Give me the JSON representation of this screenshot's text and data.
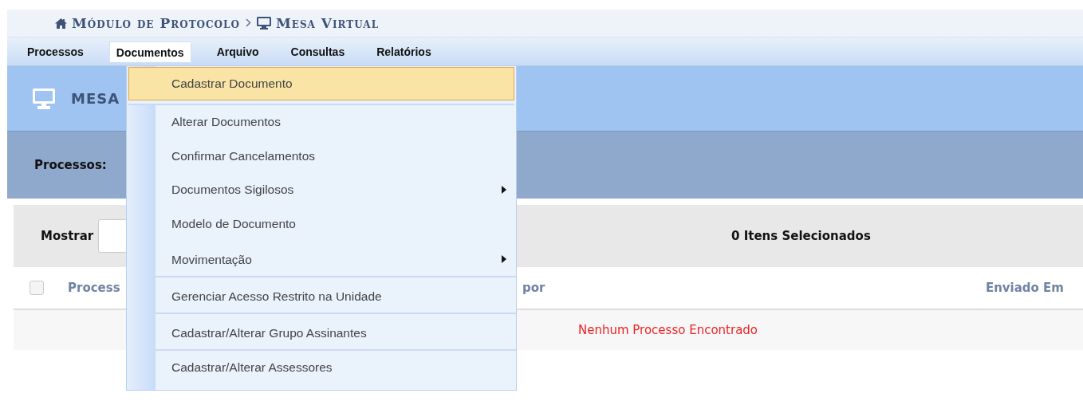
{
  "breadcrumb": [
    {
      "kind": "home",
      "text": "Módulo de Protocolo"
    },
    {
      "kind": "desk",
      "text": "Mesa Virtual"
    }
  ],
  "menu": [
    {
      "label": "Processos",
      "selected": false
    },
    {
      "label": "Documentos",
      "selected": true
    },
    {
      "label": "Arquivo",
      "selected": false
    },
    {
      "label": "Consultas",
      "selected": false
    },
    {
      "label": "Relatórios",
      "selected": false
    }
  ],
  "dropdown": [
    {
      "label": "Cadastrar Documento",
      "selected": true,
      "submenu": false,
      "separator_after": true
    },
    {
      "label": "Alterar Documentos",
      "selected": false,
      "submenu": false,
      "separator_after": false
    },
    {
      "label": "Confirmar Cancelamentos",
      "selected": false,
      "submenu": false,
      "separator_after": false
    },
    {
      "label": "Documentos Sigilosos",
      "selected": false,
      "submenu": true,
      "separator_after": false
    },
    {
      "label": "Modelo de Documento",
      "selected": false,
      "submenu": false,
      "separator_after": false
    },
    {
      "label": "Movimentação",
      "selected": false,
      "submenu": true,
      "separator_after": true
    },
    {
      "label": "Gerenciar Acesso Restrito na Unidade",
      "selected": false,
      "submenu": false,
      "separator_after": true
    },
    {
      "label": "Cadastrar/Alterar Grupo Assinantes",
      "selected": false,
      "submenu": false,
      "separator_after": true
    },
    {
      "label": "Cadastrar/Alterar Assessores",
      "selected": false,
      "submenu": false,
      "separator_after": false
    }
  ],
  "page_header": {
    "title": "MESA"
  },
  "filter": {
    "label": "Processos:"
  },
  "toolbar": {
    "show_label": "Mostrar",
    "selection_count": "0 Itens Selecionados"
  },
  "table": {
    "select_all_checked": false,
    "columns": [
      "Process",
      "por",
      "Enviado Em"
    ],
    "empty_message": "Nenhum Processo Encontrado"
  }
}
